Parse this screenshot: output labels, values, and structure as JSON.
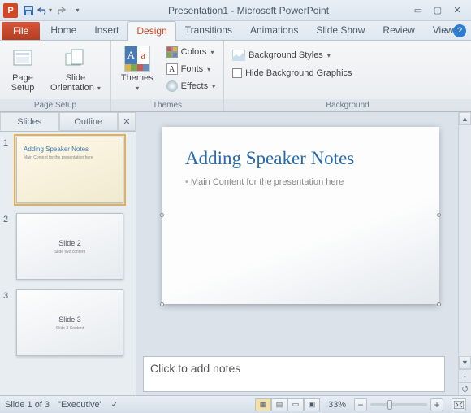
{
  "titlebar": {
    "title": "Presentation1 - Microsoft PowerPoint"
  },
  "tabs": {
    "file": "File",
    "items": [
      "Home",
      "Insert",
      "Design",
      "Transitions",
      "Animations",
      "Slide Show",
      "Review",
      "View"
    ],
    "active": "Design"
  },
  "ribbon": {
    "page_setup": {
      "label": "Page Setup",
      "setup": "Page\nSetup",
      "orientation": "Slide\nOrientation"
    },
    "themes": {
      "label": "Themes",
      "themes_btn": "Themes",
      "colors": "Colors",
      "fonts": "Fonts",
      "effects": "Effects"
    },
    "background": {
      "label": "Background",
      "styles": "Background Styles",
      "hide": "Hide Background Graphics"
    }
  },
  "sidepanel": {
    "tab_slides": "Slides",
    "tab_outline": "Outline",
    "thumbs": [
      {
        "num": "1",
        "title": "Adding Speaker Notes",
        "body": "Main Content for the presentation here"
      },
      {
        "num": "2",
        "title": "Slide 2",
        "body": "Slide two content"
      },
      {
        "num": "3",
        "title": "Slide 3",
        "body": "Slide 3 Content"
      }
    ]
  },
  "slide": {
    "title": "Adding Speaker Notes",
    "body": "Main Content for the presentation here"
  },
  "notes": {
    "placeholder": "Click to add notes"
  },
  "status": {
    "slide_info": "Slide 1 of 3",
    "theme": "\"Executive\"",
    "zoom": "33%"
  }
}
